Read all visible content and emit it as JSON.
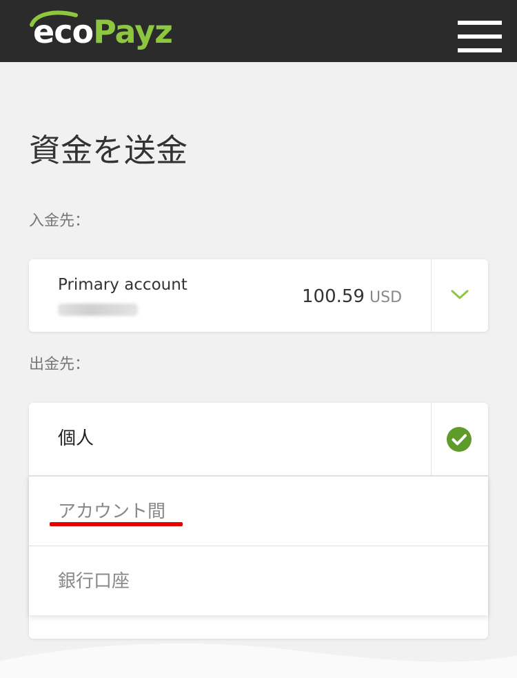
{
  "header": {
    "logo_eco": "eco",
    "logo_payz": "Payz",
    "brand_color": "#8dc63f",
    "menu_icon": "hamburger-menu-icon"
  },
  "page": {
    "title": "資金を送金"
  },
  "deposit_to": {
    "label": "入金先：",
    "account_name": "Primary account",
    "balance": "100.59",
    "currency": "USD",
    "toggle_icon": "chevron-down-icon"
  },
  "withdraw_from": {
    "label": "出金先：",
    "selected": "個人",
    "selected_icon": "check-circle-icon",
    "check_color": "#5e9b2b",
    "options": [
      {
        "label": "アカウント間"
      },
      {
        "label": "銀行口座"
      }
    ],
    "highlight_color": "#e60000"
  }
}
